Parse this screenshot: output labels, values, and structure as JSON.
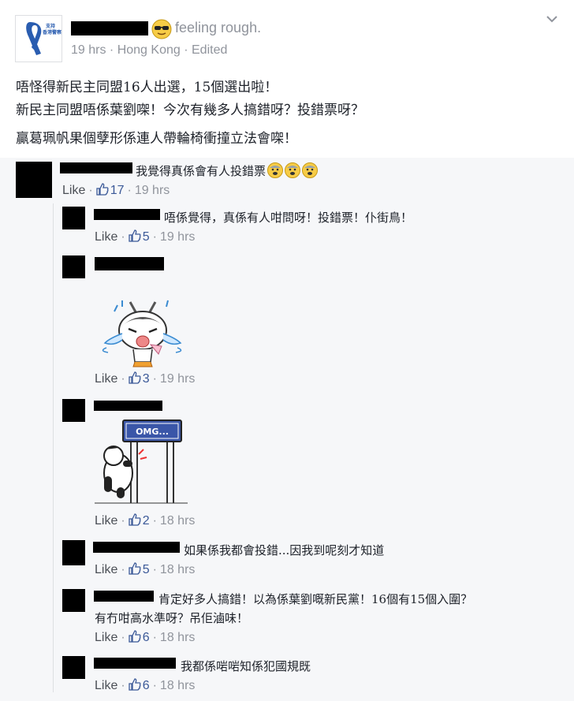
{
  "post": {
    "feeling": "feeling rough.",
    "time": "19 hrs",
    "location": "Hong Kong",
    "edited": "Edited",
    "sep": "·",
    "logo_text_1": "支持",
    "logo_text_2": "香港警察",
    "line1": "唔怪得新民主同盟16人出選，15個選出啦！",
    "line2": "新民主同盟唔係葉劉㗎！今次有幾多人搞錯呀？投錯票呀？",
    "line3": "贏葛珮帆果個孽形係連人帶輪椅衝撞立法會㗎！"
  },
  "comments": [
    {
      "text": "我覺得真係會有人投錯票",
      "like": "Like",
      "count": "17",
      "time": "19 hrs"
    },
    {
      "text": "唔係覺得，真係有人咁問呀！投錯票！仆街鳥！",
      "like": "Like",
      "count": "5",
      "time": "19 hrs"
    },
    {
      "text": "",
      "like": "Like",
      "count": "3",
      "time": "19 hrs"
    },
    {
      "text": "",
      "sign_text": "OMG...",
      "like": "Like",
      "count": "2",
      "time": "18 hrs"
    },
    {
      "text": "如果係我都會投錯...因我到呢刻才知道",
      "like": "Like",
      "count": "5",
      "time": "18 hrs"
    },
    {
      "text": "肯定好多人搞錯！以為係葉劉嘅新民黨！16個有15個入圍？",
      "text2": "有冇咁高水準呀？吊佢滷味！",
      "like": "Like",
      "count": "6",
      "time": "18 hrs"
    },
    {
      "text": "我都係啱啱知係犯國規既",
      "like": "Like",
      "count": "6",
      "time": "18 hrs"
    }
  ],
  "colors": {
    "link": "#3b5998",
    "muted": "#90949c",
    "ribbon": "#2a5db0",
    "bg_comments": "#f6f7f9"
  }
}
